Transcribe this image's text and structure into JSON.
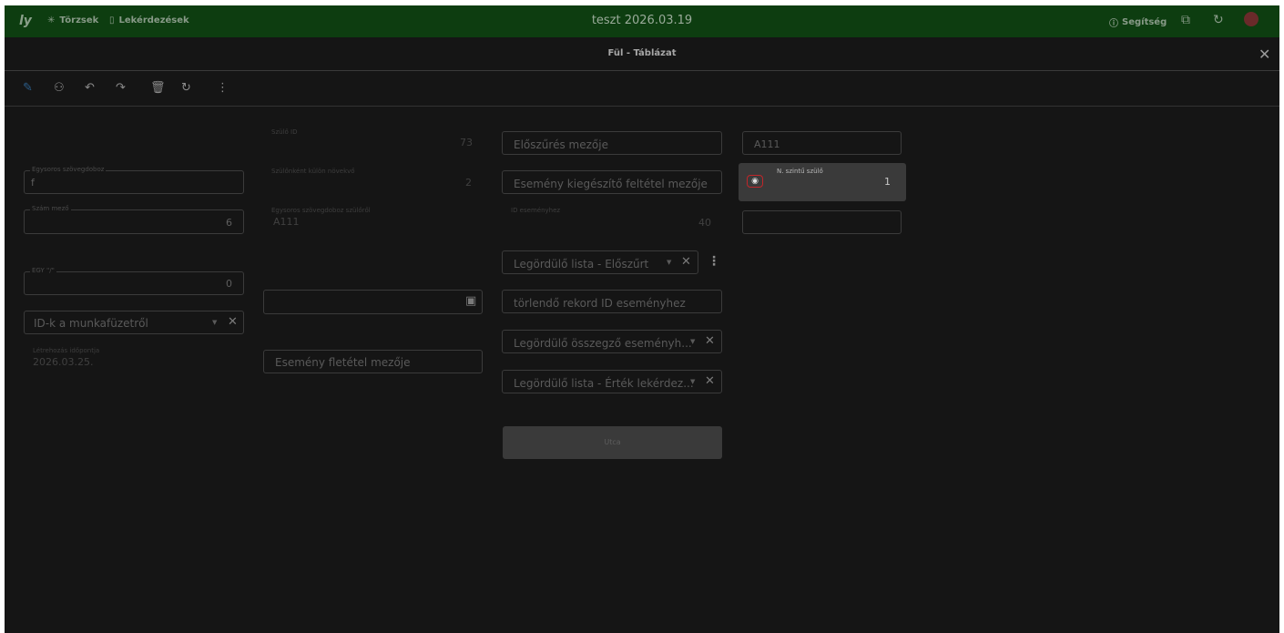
{
  "topbar": {
    "logo": "ly",
    "nav": [
      {
        "label": "Törzsek",
        "icon": "asterisk-icon"
      },
      {
        "label": "Lekérdezések",
        "icon": "document-icon"
      }
    ],
    "title": "teszt 2026.03.19",
    "help_label": "Segítség"
  },
  "subheader": {
    "title": "Fül - Táblázat",
    "close": "✕"
  },
  "left": {
    "egysoros": {
      "label": "Egysoros szövegdoboz",
      "value": "f"
    },
    "szam": {
      "label": "Szám mező",
      "value": "6"
    },
    "egy": {
      "label": "EGY \"/\"",
      "value": "0"
    },
    "idk": {
      "placeholder": "ID-k a munkafüzetről"
    },
    "letrehozas": {
      "label": "Létrehozás időpontja",
      "value": "2026.03.25."
    }
  },
  "middle": {
    "szulo_id": {
      "label": "Szülő ID",
      "value": "73"
    },
    "szulonkent": {
      "label": "Szülőnként külön növekvő",
      "value": "2"
    },
    "egysoros_szulo": {
      "label": "Egysoros szövegdoboz szülőről",
      "value": "A111"
    },
    "date": {
      "value": ""
    },
    "esemeny_feltetel": {
      "placeholder": "Esemény fletétel mezője"
    }
  },
  "right": {
    "elosz": {
      "placeholder": "Előszűrés mezője"
    },
    "kieg": {
      "placeholder": "Esemény kiegészítő feltétel mezője"
    },
    "id_esemeny": {
      "label": "ID eseményhez",
      "value": "40"
    },
    "legord1": {
      "placeholder": "Legördülő lista - Előszűrt"
    },
    "torlendo": {
      "placeholder": "törlendő rekord ID eseményhez"
    },
    "legord2": {
      "placeholder": "Legördülő összegző eseményh..."
    },
    "legord3": {
      "placeholder": "Legördülő lista - Érték lekérdez..."
    },
    "utca_button": "Utca"
  },
  "far_right": {
    "a111": {
      "value": "A111"
    },
    "n_szintu": {
      "label": "N. szintű szülő",
      "value": "1"
    },
    "empty": {
      "value": ""
    }
  }
}
